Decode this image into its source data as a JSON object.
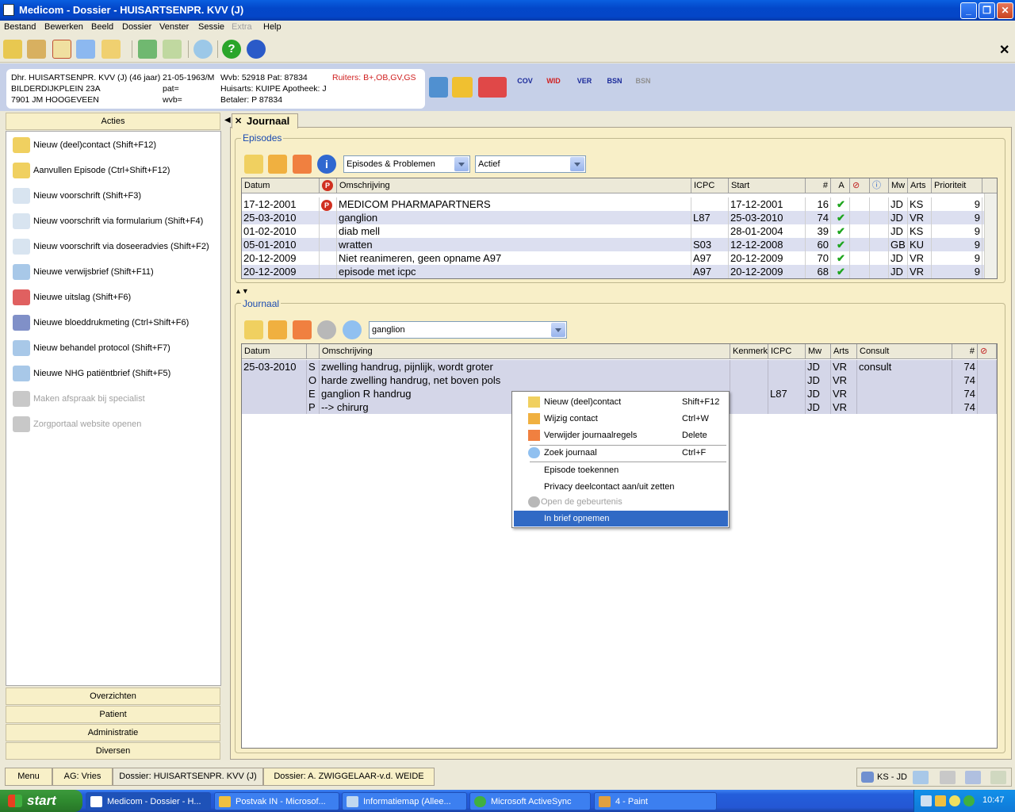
{
  "window": {
    "title": "Medicom - Dossier - HUISARTSENPR. KVV (J)",
    "min": "_",
    "max": "❐",
    "close": "✕"
  },
  "menu": [
    "Bestand",
    "Bewerken",
    "Beeld",
    "Dossier",
    "Venster",
    "Sessie",
    "Extra",
    "Help"
  ],
  "toolbar": {
    "close_x": "✕"
  },
  "patient": {
    "line1": "Dhr. HUISARTSENPR. KVV (J) (46 jaar)",
    "dob": "21-05-1963/M",
    "wvb": "Wvb: 52918 Pat: 87834",
    "ruiters": "Ruiters: B+,OB,GV,GS",
    "addr1": "BILDERDIJKPLEIN 23A",
    "pat": "pat=",
    "huisarts": "Huisarts: KUIPE Apotheek: J",
    "addr2": "7901 JM HOOGEVEEN",
    "wvb2": "wvb=",
    "betaler": "Betaler: P 87834"
  },
  "header_icons": [
    "COV",
    "WID",
    "VER",
    "BSN",
    "BSN"
  ],
  "left": {
    "acties_title": "Acties",
    "actions": [
      {
        "label": "Nieuw (deel)contact   (Shift+F12)",
        "enabled": true
      },
      {
        "label": "Aanvullen Episode   (Ctrl+Shift+F12)",
        "enabled": true
      },
      {
        "label": "Nieuw voorschrift   (Shift+F3)",
        "enabled": true
      },
      {
        "label": "Nieuw voorschrift via formularium   (Shift+F4)",
        "enabled": true
      },
      {
        "label": "Nieuw voorschrift via doseeradvies   (Shift+F2)",
        "enabled": true
      },
      {
        "label": "Nieuwe verwijsbrief   (Shift+F11)",
        "enabled": true
      },
      {
        "label": "Nieuwe uitslag   (Shift+F6)",
        "enabled": true
      },
      {
        "label": "Nieuwe bloeddrukmeting   (Ctrl+Shift+F6)",
        "enabled": true
      },
      {
        "label": "Nieuw behandel protocol   (Shift+F7)",
        "enabled": true
      },
      {
        "label": "Nieuwe NHG patiëntbrief   (Shift+F5)",
        "enabled": true
      },
      {
        "label": "Maken afspraak bij specialist",
        "enabled": false
      },
      {
        "label": "Zorgportaal website openen",
        "enabled": false
      }
    ],
    "sections": [
      "Overzichten",
      "Patient",
      "Administratie",
      "Diversen"
    ]
  },
  "journaal_tab": "Journaal",
  "episodes": {
    "title": "Episodes",
    "filter1": "Episodes & Problemen",
    "filter2": "Actief",
    "columns": [
      "Datum",
      "",
      "Omschrijving",
      "ICPC",
      "Start",
      "#",
      "A",
      "",
      "",
      "Mw",
      "Arts",
      "Prioriteit"
    ],
    "rows": [
      {
        "datum": "17-12-2001",
        "p": true,
        "omschrijving": "MEDICOM PHARMAPARTNERS",
        "icpc": "",
        "start": "17-12-2001",
        "n": "16",
        "mw": "JD",
        "arts": "KS",
        "prio": "9"
      },
      {
        "datum": "25-03-2010",
        "p": false,
        "omschrijving": "ganglion",
        "icpc": "L87",
        "start": "25-03-2010",
        "n": "74",
        "mw": "JD",
        "arts": "VR",
        "prio": "9"
      },
      {
        "datum": "01-02-2010",
        "p": false,
        "omschrijving": "diab mell",
        "icpc": "",
        "start": "28-01-2004",
        "n": "39",
        "mw": "JD",
        "arts": "KS",
        "prio": "9"
      },
      {
        "datum": "05-01-2010",
        "p": false,
        "omschrijving": "wratten",
        "icpc": "S03",
        "start": "12-12-2008",
        "n": "60",
        "mw": "GB",
        "arts": "KU",
        "prio": "9"
      },
      {
        "datum": "20-12-2009",
        "p": false,
        "omschrijving": "Niet reanimeren, geen opname A97",
        "icpc": "A97",
        "start": "20-12-2009",
        "n": "70",
        "mw": "JD",
        "arts": "VR",
        "prio": "9"
      },
      {
        "datum": "20-12-2009",
        "p": false,
        "omschrijving": "episode met icpc",
        "icpc": "A97",
        "start": "20-12-2009",
        "n": "68",
        "mw": "JD",
        "arts": "VR",
        "prio": "9"
      }
    ]
  },
  "journaal": {
    "title": "Journaal",
    "search_value": "ganglion",
    "columns": [
      "Datum",
      "",
      "Omschrijving",
      "Kenmerk",
      "ICPC",
      "Mw",
      "Arts",
      "Consult",
      "#",
      ""
    ],
    "rows": [
      {
        "datum": "25-03-2010",
        "s": "S",
        "omschrijving": "zwelling handrug, pijnlijk, wordt groter",
        "kenmerk": "",
        "icpc": "",
        "mw": "JD",
        "arts": "VR",
        "consult": "consult",
        "n": "74"
      },
      {
        "datum": "",
        "s": "O",
        "omschrijving": "harde zwelling handrug, net boven pols",
        "kenmerk": "",
        "icpc": "",
        "mw": "JD",
        "arts": "VR",
        "consult": "",
        "n": "74"
      },
      {
        "datum": "",
        "s": "E",
        "omschrijving": "ganglion R handrug",
        "kenmerk": "",
        "icpc": "L87",
        "mw": "JD",
        "arts": "VR",
        "consult": "",
        "n": "74"
      },
      {
        "datum": "",
        "s": "P",
        "omschrijving": "--> chirurg",
        "kenmerk": "",
        "icpc": "",
        "mw": "JD",
        "arts": "VR",
        "consult": "",
        "n": "74"
      }
    ]
  },
  "context_menu": [
    {
      "label": "Nieuw (deel)contact",
      "shortcut": "Shift+F12",
      "enabled": true
    },
    {
      "label": "Wijzig contact",
      "shortcut": "Ctrl+W",
      "enabled": true
    },
    {
      "label": "Verwijder journaalregels",
      "shortcut": "Delete",
      "enabled": true
    },
    {
      "label": "Zoek journaal",
      "shortcut": "Ctrl+F",
      "enabled": true
    },
    {
      "label": "Episode toekennen",
      "shortcut": "",
      "enabled": true
    },
    {
      "label": "Privacy deelcontact aan/uit zetten",
      "shortcut": "",
      "enabled": true
    },
    {
      "label": "Open de gebeurtenis",
      "shortcut": "",
      "enabled": false
    },
    {
      "label": "In brief opnemen",
      "shortcut": "",
      "enabled": true,
      "selected": true
    }
  ],
  "bottom_tabs": [
    "Menu",
    "AG: Vries",
    "Dossier: HUISARTSENPR. KVV (J)",
    "Dossier: A. ZWIGGELAAR-v.d. WEIDE"
  ],
  "status": {
    "user": "KS - JD"
  },
  "taskbar": {
    "start": "start",
    "tasks": [
      "Medicom - Dossier - H...",
      "Postvak IN - Microsof...",
      "Informatiemap (Allee...",
      "Microsoft ActiveSync",
      "4 - Paint"
    ],
    "clock": "10:47"
  }
}
